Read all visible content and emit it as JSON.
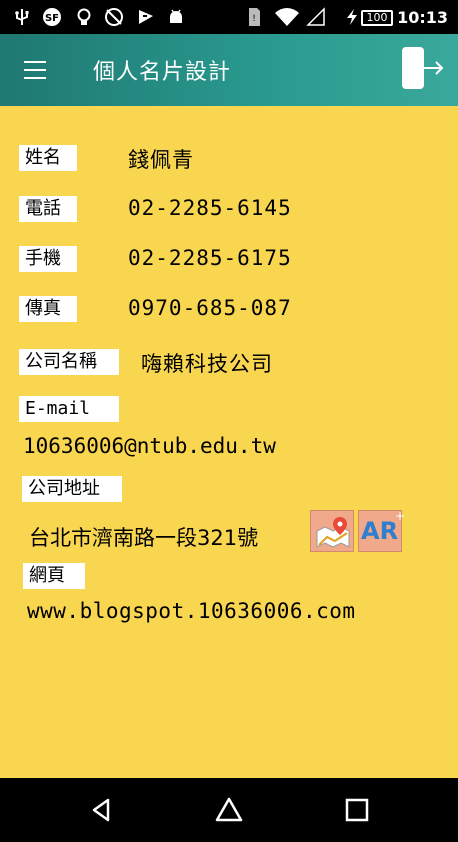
{
  "status_bar": {
    "time": "10:13",
    "battery": "100",
    "icons": [
      "usb-icon",
      "sf-icon",
      "bulb-icon",
      "no-sync-icon",
      "flag-icon",
      "android-icon",
      "sim-icon",
      "wifi-icon",
      "signal-icon",
      "charging-icon"
    ]
  },
  "app_bar": {
    "title": "個人名片設計",
    "menu_icon": "hamburger-menu-icon",
    "exit_icon": "exit-arrow-icon"
  },
  "card": {
    "name_label": "姓名",
    "name_value": "錢佩青",
    "phone_label": "電話",
    "phone_value": "02-2285-6145",
    "mobile_label": "手機",
    "mobile_value": "02-2285-6175",
    "fax_label": "傳真",
    "fax_value": "0970-685-087",
    "company_label": "公司名稱",
    "company_value": "嗨賴科技公司",
    "email_label": "E-mail",
    "email_value": "10636006@ntub.edu.tw",
    "address_label": "公司地址",
    "address_value": "台北市濟南路一段321號",
    "map_button_icon": "map-pin-icon",
    "ar_button_text": "AR",
    "ar_button_plus": "+",
    "website_label": "網頁",
    "website_value": "www.blogspot.10636006.com"
  },
  "colors": {
    "background": "#f9d64f",
    "appbar_start": "#1f7872",
    "appbar_end": "#3aa99b",
    "label_bg": "#ffffff",
    "ar_text": "#2f7fd0",
    "icon_button_bg": "#f0a98a"
  },
  "nav_bar": {
    "back_icon": "back-triangle-icon",
    "home_icon": "home-icon",
    "recents_icon": "recents-square-icon"
  }
}
